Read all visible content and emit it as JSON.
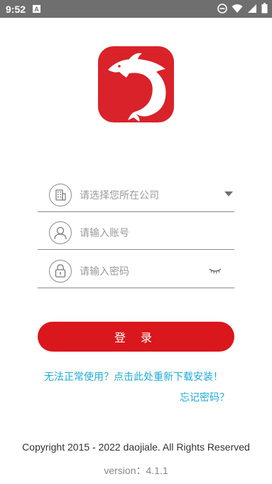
{
  "status_bar": {
    "time": "9:52",
    "notification_icon": "A"
  },
  "logo": {
    "icon": "dolphin-logo",
    "color": "#d9222a"
  },
  "form": {
    "company": {
      "placeholder": "请选择您所在公司",
      "icon": "building-icon"
    },
    "account": {
      "placeholder": "请输入账号",
      "icon": "user-icon"
    },
    "password": {
      "placeholder": "请输入密码",
      "icon": "lock-icon"
    }
  },
  "login_button": {
    "label": "登 录",
    "color": "#d9171c"
  },
  "links": {
    "help": "无法正常使用？点击此处重新下载安装！",
    "forgot": "忘记密码？",
    "color": "#1faad8"
  },
  "footer": {
    "copyright": "Copyright 2015 - 2022 daojiale. All Rights Reserved",
    "version": "version：4.1.1"
  }
}
